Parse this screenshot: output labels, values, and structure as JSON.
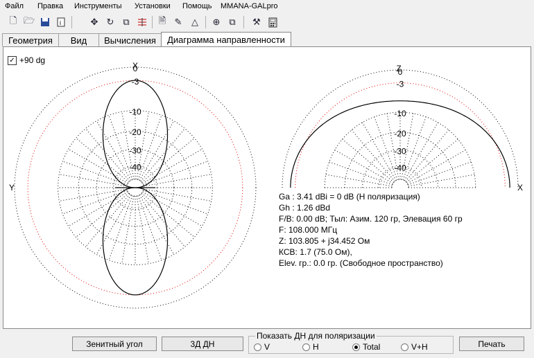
{
  "menu": [
    "Файл",
    "Правка",
    "Инструменты",
    "Установки",
    "Помощь",
    "MMANA-GALpro"
  ],
  "toolbar": [
    "new-file-icon",
    "open-folder-icon",
    "save-icon",
    "info-icon",
    "move-icon",
    "rotate-icon",
    "copy-icon",
    "elements-icon",
    "document-icon",
    "edit-icon",
    "triangle-icon",
    "target-icon",
    "duplicate-icon",
    "tools-icon",
    "calculator-icon"
  ],
  "tabs": [
    "Геометрия",
    "Вид",
    "Вычисления",
    "Диаграмма направленности"
  ],
  "active_tab": 3,
  "checkbox": {
    "label": "+90 dg",
    "checked": true
  },
  "plots": {
    "horizontal": {
      "top_axis": "X",
      "left_axis": "Y",
      "rings": [
        "0",
        "-3",
        "-10",
        "-20",
        "-30",
        "-40"
      ]
    },
    "vertical": {
      "top_axis": "Z",
      "right_axis": "X",
      "rings": [
        "0",
        "-3",
        "-10",
        "-20",
        "-30",
        "-40"
      ]
    }
  },
  "info_lines": [
    "Ga : 3.41 dBi = 0 dB  (Н поляризация)",
    "Gh : 1.26 dBd",
    "F/B: 0.00 dB; Тыл: Азим. 120 гр, Элевация 60 гр",
    "F: 108.000 МГц",
    "Z: 103.805 + j34.452 Ом",
    "КСВ: 1.7 (75.0 Ом),",
    "Elev. гр.: 0.0 гр. (Свободное пространство)"
  ],
  "buttons": {
    "zenith": "Зенитный угол",
    "3d": "3Д   ДН",
    "print": "Печать"
  },
  "polarization": {
    "title": "Показать ДН для поляризации",
    "options": [
      "V",
      "H",
      "Total",
      "V+H"
    ],
    "selected": "Total"
  },
  "colors": {
    "pattern": "#000000",
    "ref_ring": "#e00000",
    "grid": "#000000"
  }
}
